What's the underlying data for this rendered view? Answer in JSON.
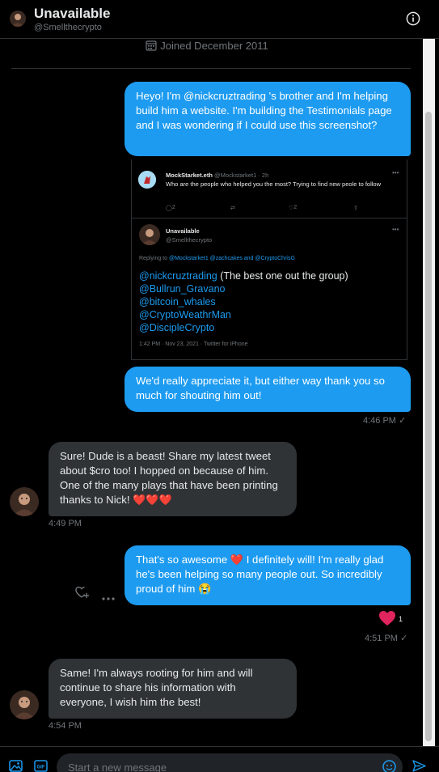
{
  "header": {
    "name": "Unavailable",
    "handle": "@Smellthecrypto",
    "info_icon": "info-circle-icon"
  },
  "profile": {
    "joined": "Joined December 2011",
    "calendar_icon": "calendar-icon"
  },
  "messages": [
    {
      "direction": "sent",
      "text": "Heyo! I'm @nickcruztrading 's brother and I'm helping build him a website. I'm building the Testimonials page and I was wondering if I could use this screenshot?"
    },
    {
      "direction": "sent",
      "type": "image",
      "embedded_tweet": {
        "parent": {
          "name": "MockStarket.eth",
          "handle": "@Mockstarket1",
          "time": "· 2h",
          "text": "Who are the people who helped you the most? Trying to find new peole to follow",
          "replies": "2",
          "likes": "2"
        },
        "reply": {
          "name": "Unavailable",
          "handle": "@Smellthecrypto",
          "replying_prefix": "Replying to",
          "replying_to": "@Mockstarket1 @zachcakes and @CryptoChrisG",
          "first_mention": "@nickcruztrading",
          "first_mention_note": " (The best one out the group)",
          "mentions": [
            "@Bullrun_Gravano",
            "@bitcoin_whales",
            "@CryptoWeathrMan",
            "@DiscipleCrypto"
          ],
          "date": "1:42 PM · Nov 23, 2021 · Twitter for iPhone"
        }
      }
    },
    {
      "direction": "sent",
      "text": "We'd really appreciate it, but either way thank you so much for shouting him out!",
      "time": "4:46 PM ✓"
    },
    {
      "direction": "received",
      "text": "Sure! Dude is a beast! Share my latest tweet about $cro too! I hopped on because of him. One of the many plays that have been printing thanks to Nick! ",
      "emoji": "❤️❤️❤️",
      "time": "4:49 PM"
    },
    {
      "direction": "sent",
      "text_before": "That's so awesome ",
      "emoji": "❤️",
      "text_after": " I definitely will! I'm really glad he's been helping so many people out. So incredibly proud of him ",
      "emoji_end": "😭",
      "reaction": {
        "emoji": "❤️",
        "count": "1"
      },
      "time": "4:51 PM ✓"
    },
    {
      "direction": "received",
      "text": "Same! I'm always rooting for him and will continue to share his information with everyone, I wish him the best!",
      "time": "4:54 PM"
    }
  ],
  "composer": {
    "placeholder": "Start a new message",
    "media_icon": "image-icon",
    "gif_icon": "gif-icon",
    "emoji_icon": "emoji-icon",
    "send_icon": "send-icon"
  },
  "colors": {
    "accent": "#1d9bf0",
    "background": "#000000",
    "received_bubble": "#2f3336",
    "heart": "#f91880"
  }
}
